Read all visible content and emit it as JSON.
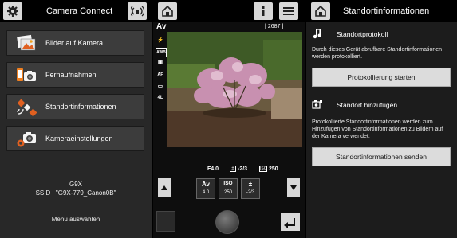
{
  "home": {
    "title": "Camera Connect",
    "menu": [
      {
        "label": "Bilder auf Kamera",
        "icon": "images-icon"
      },
      {
        "label": "Fernaufnahmen",
        "icon": "remote-shooting-icon"
      },
      {
        "label": "Standortinformationen",
        "icon": "satellite-icon"
      },
      {
        "label": "Kameraeinstellungen",
        "icon": "camera-settings-icon"
      }
    ],
    "camera_model": "G9X",
    "ssid": "SSID : \"G9X-779_Canon0B\"",
    "menu_select": "Menü auswählen"
  },
  "remote": {
    "mode": "Av",
    "shots": "[ 2687 ]",
    "battery": "▮",
    "side_icons": [
      "⚡",
      "AWB",
      "▣",
      "AF",
      "▭",
      "4L"
    ],
    "exposure": {
      "aperture": "F4.0",
      "compensation": "-2/3",
      "iso": "250"
    },
    "controls": [
      {
        "label": "Av",
        "value": "4.0"
      },
      {
        "label": "ISO",
        "value": "250"
      },
      {
        "label": "±",
        "value": "-2/3"
      }
    ]
  },
  "location": {
    "title": "Standortinformationen",
    "log_title": "Standortprotokoll",
    "log_desc": "Durch dieses Gerät abrufbare Standortinformationen werden protokolliert.",
    "log_button": "Protokollierung starten",
    "add_title": "Standort hinzufügen",
    "add_desc": "Protokollierte Standortinformationen werden zum Hinzufügen von Standortinformationen zu Bildern auf der Kamera verwendet.",
    "send_button": "Standortinformationen senden"
  }
}
